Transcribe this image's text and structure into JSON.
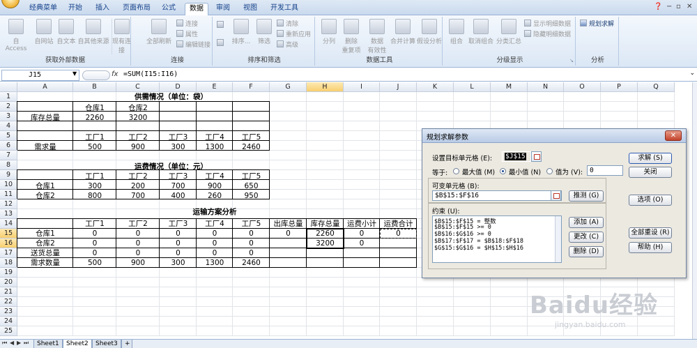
{
  "ribbon": {
    "tabs": [
      "经典菜单",
      "开始",
      "插入",
      "页面布局",
      "公式",
      "数据",
      "审阅",
      "视图",
      "开发工具"
    ],
    "active_tab": "数据",
    "groups": {
      "external": {
        "title": "获取外部数据",
        "access": "自 Access",
        "web": "自网站",
        "text": "自文本",
        "other": "自其他来源",
        "existing": "现有连接"
      },
      "connections": {
        "title": "连接",
        "refresh_all": "全部刷新",
        "connections": "连接",
        "properties": "属性",
        "edit_links": "编辑链接"
      },
      "sort_filter": {
        "title": "排序和筛选",
        "sort": "排序...",
        "filter": "筛选",
        "clear": "清除",
        "reapply": "重新应用",
        "advanced": "高级"
      },
      "data_tools": {
        "title": "数据工具",
        "split": "分列",
        "remove_dup_1": "删除",
        "remove_dup_2": "重复项",
        "validation_1": "数据",
        "validation_2": "有效性",
        "consolidate": "合并计算",
        "whatif": "假设分析"
      },
      "outline": {
        "title": "分级显示",
        "group": "组合",
        "ungroup": "取消组合",
        "subtotal": "分类汇总",
        "show_detail": "显示明细数据",
        "hide_detail": "隐藏明细数据"
      },
      "analysis": {
        "title": "分析",
        "solver": "规划求解"
      }
    }
  },
  "formula_bar": {
    "name_box": "J15",
    "fx": "fx",
    "formula": "=SUM(I15:I16)"
  },
  "columns": [
    "A",
    "B",
    "C",
    "D",
    "E",
    "F",
    "G",
    "H",
    "I",
    "J",
    "K",
    "L",
    "M",
    "N",
    "O",
    "P",
    "Q"
  ],
  "rows": [
    "1",
    "2",
    "3",
    "4",
    "5",
    "6",
    "7",
    "8",
    "9",
    "10",
    "11",
    "12",
    "13",
    "14",
    "15",
    "16",
    "17",
    "18",
    "19",
    "20",
    "21",
    "22",
    "23",
    "24",
    "25"
  ],
  "sheet": {
    "supply_title": "供需情况（单位：袋）",
    "warehouse1": "仓库1",
    "warehouse2": "仓库2",
    "stock_total": "库存总量",
    "stock1": "2260",
    "stock2": "3200",
    "factories": [
      "工厂1",
      "工厂2",
      "工厂3",
      "工厂4",
      "工厂5"
    ],
    "demand_label": "需求量",
    "demand": [
      "500",
      "900",
      "300",
      "1300",
      "2460"
    ],
    "freight_title": "运费情况（单位：元）",
    "freight_w1": [
      "300",
      "200",
      "700",
      "900",
      "650"
    ],
    "freight_w2": [
      "800",
      "700",
      "400",
      "260",
      "950"
    ],
    "analysis_title": "运输方案分析",
    "out_total": "出库总量",
    "stock_total2": "库存总量",
    "freight_subtotal": "运费小计",
    "freight_total": "运费合计",
    "row15": [
      "0",
      "0",
      "0",
      "0",
      "0",
      "0",
      "2260",
      "0",
      "0"
    ],
    "row16": [
      "0",
      "0",
      "0",
      "0",
      "0",
      "",
      "3200",
      "0",
      ""
    ],
    "delivered_label": "送货总量",
    "row17": [
      "0",
      "0",
      "0",
      "0",
      "0"
    ],
    "need_label": "需求数量",
    "row18": [
      "500",
      "900",
      "300",
      "1300",
      "2460"
    ]
  },
  "sheet_tabs": [
    "Sheet1",
    "Sheet2",
    "Sheet3"
  ],
  "active_sheet": "Sheet2",
  "solver_dialog": {
    "title": "规划求解参数",
    "target_label": "设置目标单元格 (E):",
    "target_value": "$J$15",
    "equal_label": "等于:",
    "max_label": "最大值 (M)",
    "min_label": "最小值 (N)",
    "value_label": "值为 (V):",
    "value_input": "0",
    "changing_label": "可变单元格 (B):",
    "changing_value": "$B$15:$F$16",
    "guess_btn": "推测 (G)",
    "constraints_label": "约束 (U):",
    "constraints": [
      "$B$15:$F$15 = 整数",
      "$B$15:$F$15 >= 0",
      "$B$16:$G$16 >= 0",
      "$B$17:$F$17 = $B$18:$F$18",
      "$G$15:$G$16 = $H$15:$H$16"
    ],
    "add_btn": "添加 (A)",
    "change_btn": "更改 (C)",
    "delete_btn": "删除 (D)",
    "solve_btn": "求解 (S)",
    "close_btn": "关闭",
    "options_btn": "选项 (O)",
    "reset_btn": "全部重设 (R)",
    "help_btn": "帮助 (H)"
  },
  "watermark": {
    "brand": "Baidu经验",
    "url": "jingyan.baidu.com"
  }
}
